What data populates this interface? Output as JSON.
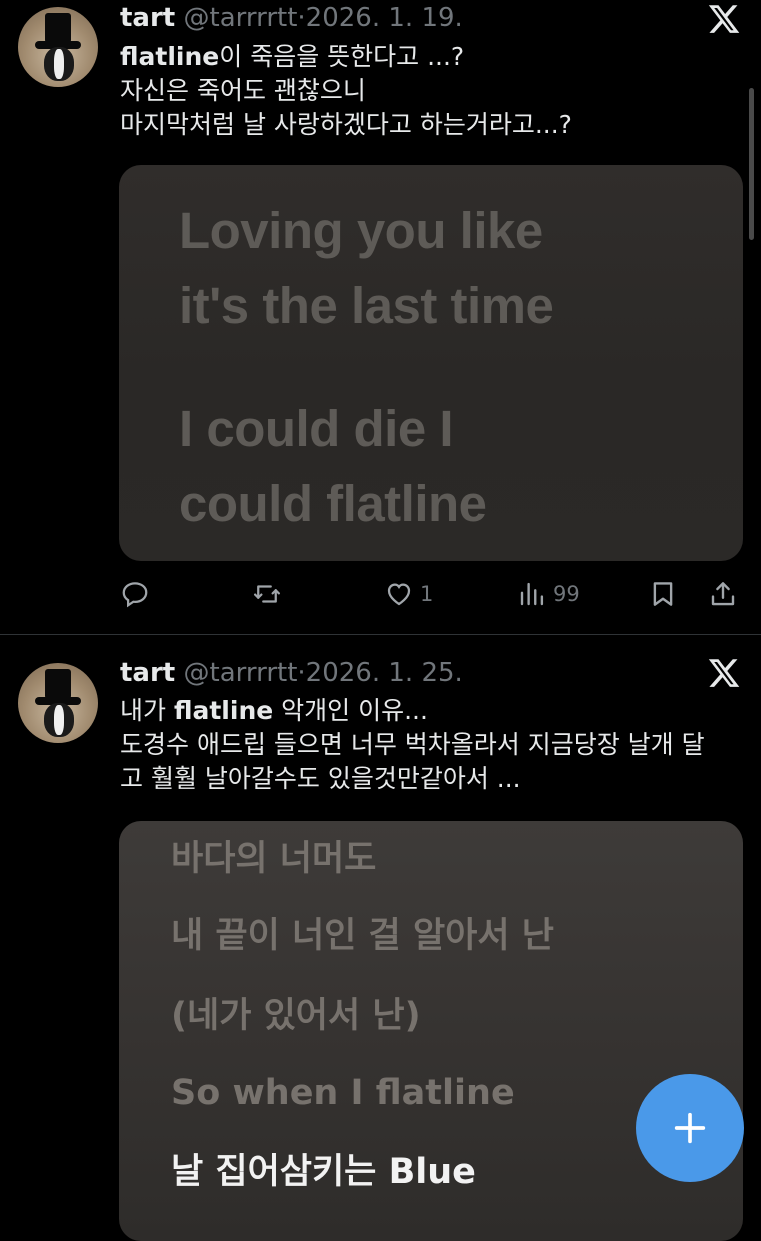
{
  "tweets": [
    {
      "name": "tart",
      "handle": "@tarrrrtt",
      "sep": "·",
      "date": "2026. 1. 19.",
      "lines": [
        {
          "bold": "flatline",
          "rest": "이 죽음을 뜻한다고 ...?"
        },
        {
          "bold": "",
          "rest": "자신은 죽어도 괜찮으니"
        },
        {
          "bold": "",
          "rest": "마지막처럼 날 사랑하겠다고 하는거라고...?"
        }
      ],
      "media_lines": [
        "Loving you like",
        "it's the last time",
        "I could die I",
        "could flatline"
      ],
      "actions": {
        "reply_count": "",
        "retweet_count": "",
        "like_count": "1",
        "view_count": "99"
      }
    },
    {
      "name": "tart",
      "handle": "@tarrrrtt",
      "sep": "·",
      "date": "2026. 1. 25.",
      "lines": [
        {
          "pre": "내가 ",
          "bold": "flatline",
          "rest": " 악개인 이유..."
        },
        {
          "pre": "",
          "bold": "",
          "rest": "도경수 애드립 들으면 너무 벅차올라서 지금당장 날개 달"
        },
        {
          "pre": "",
          "bold": "",
          "rest": "고 훨훨 날아갈수도 있을것만같아서 ..."
        }
      ],
      "media_lines": [
        "바다의 너머도",
        "내 끝이 너인 걸 알아서 난",
        "(네가 있어서 난)",
        "So when I flatline",
        "날 집어삼키는 Blue"
      ]
    }
  ],
  "icons": {
    "x_logo": "x-logo-icon",
    "reply": "reply-icon",
    "retweet": "retweet-icon",
    "like": "heart-icon",
    "views": "views-icon",
    "bookmark": "bookmark-icon",
    "share": "share-icon",
    "compose": "plus-icon"
  },
  "colors": {
    "accent": "#4a99e9",
    "muted": "#71767b",
    "text": "#e7e9ea"
  }
}
